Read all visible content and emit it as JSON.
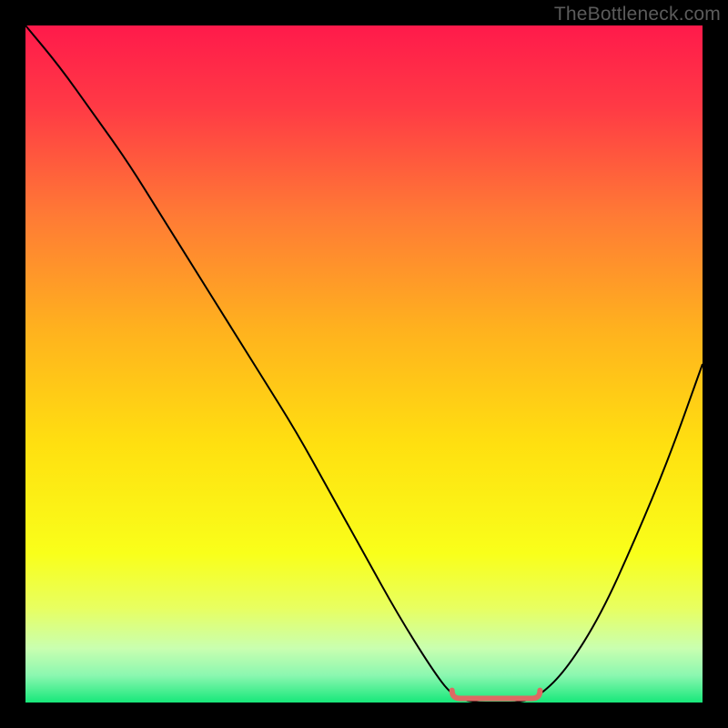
{
  "watermark": "TheBottleneck.com",
  "chart_data": {
    "type": "line",
    "title": "",
    "xlabel": "",
    "ylabel": "",
    "xlim": [
      0,
      100
    ],
    "ylim": [
      0,
      100
    ],
    "series": [
      {
        "name": "bottleneck-curve",
        "x": [
          0,
          5,
          10,
          15,
          20,
          25,
          30,
          35,
          40,
          45,
          50,
          55,
          60,
          63,
          66,
          70,
          73,
          76,
          80,
          85,
          90,
          95,
          100
        ],
        "y": [
          100,
          94,
          87,
          80,
          72,
          64,
          56,
          48,
          40,
          31,
          22,
          13,
          5,
          1,
          0,
          0,
          0,
          1,
          5,
          13,
          24,
          36,
          50
        ]
      }
    ],
    "optimal_range": {
      "x_start": 63,
      "x_end": 76,
      "y": 0
    },
    "gradient_stops": [
      {
        "pos": 0.0,
        "color": "#ff1a4b"
      },
      {
        "pos": 0.12,
        "color": "#ff3a45"
      },
      {
        "pos": 0.28,
        "color": "#ff7a35"
      },
      {
        "pos": 0.45,
        "color": "#ffb21e"
      },
      {
        "pos": 0.62,
        "color": "#ffe010"
      },
      {
        "pos": 0.78,
        "color": "#f9ff1a"
      },
      {
        "pos": 0.86,
        "color": "#e8ff60"
      },
      {
        "pos": 0.92,
        "color": "#c9ffb0"
      },
      {
        "pos": 0.96,
        "color": "#8bf7b0"
      },
      {
        "pos": 1.0,
        "color": "#17e87a"
      }
    ],
    "marker_color": "#dd6a63"
  }
}
